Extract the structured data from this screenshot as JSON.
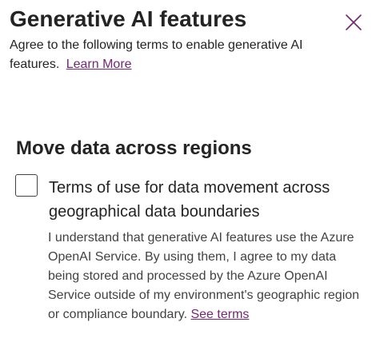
{
  "panel": {
    "title": "Generative AI features",
    "subtitle": "Agree to the following terms to enable generative AI features.",
    "learn_more_label": "Learn More",
    "close_icon": "close-icon"
  },
  "section": {
    "title": "Move data across regions",
    "checkbox_checked": false,
    "checkbox_label": "Terms of use for data movement across geographical data boundaries",
    "description": "I understand that generative AI features use the Azure OpenAI Service. By using them, I agree to my data being stored and processed by the Azure OpenAI Service outside of my environment's geographic region or compliance boundary.",
    "see_terms_label": "See terms"
  },
  "colors": {
    "link": "#742774",
    "close_icon": "#742774",
    "text": "#242424",
    "secondary_text": "#424242"
  }
}
